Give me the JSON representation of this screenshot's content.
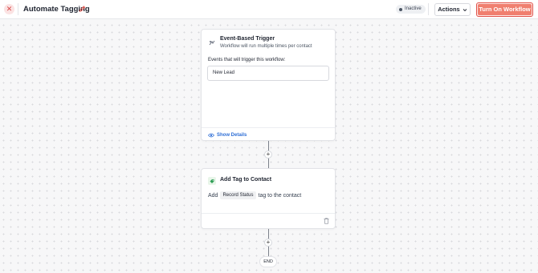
{
  "header": {
    "title": "Automate Tagging",
    "status": "Inactive",
    "actions_label": "Actions",
    "turn_on_label": "Turn On Workflow"
  },
  "trigger_card": {
    "title": "Event-Based Trigger",
    "subtitle": "Workflow will run multiple times per contact",
    "events_label": "Events that will trigger this workflow:",
    "event_value": "New Lead",
    "show_details_label": "Show Details"
  },
  "action_card": {
    "title": "Add Tag to Contact",
    "prefix": "Add",
    "tag_name": "Record Status",
    "suffix": "tag to the contact"
  },
  "end_label": "END",
  "plus_symbol": "+",
  "colors": {
    "accent": "#f07f6f",
    "accent_border": "#e0524a",
    "link": "#2f6fd6",
    "background": "#f7f7f8"
  },
  "icons": {
    "close": "close-icon",
    "edit": "pencil-icon",
    "status": "dot-icon",
    "actions_dropdown": "chevron-down-icon",
    "trigger": "trigger-icon",
    "show_details": "eye-icon",
    "tag": "tag-icon",
    "delete": "trash-icon"
  }
}
